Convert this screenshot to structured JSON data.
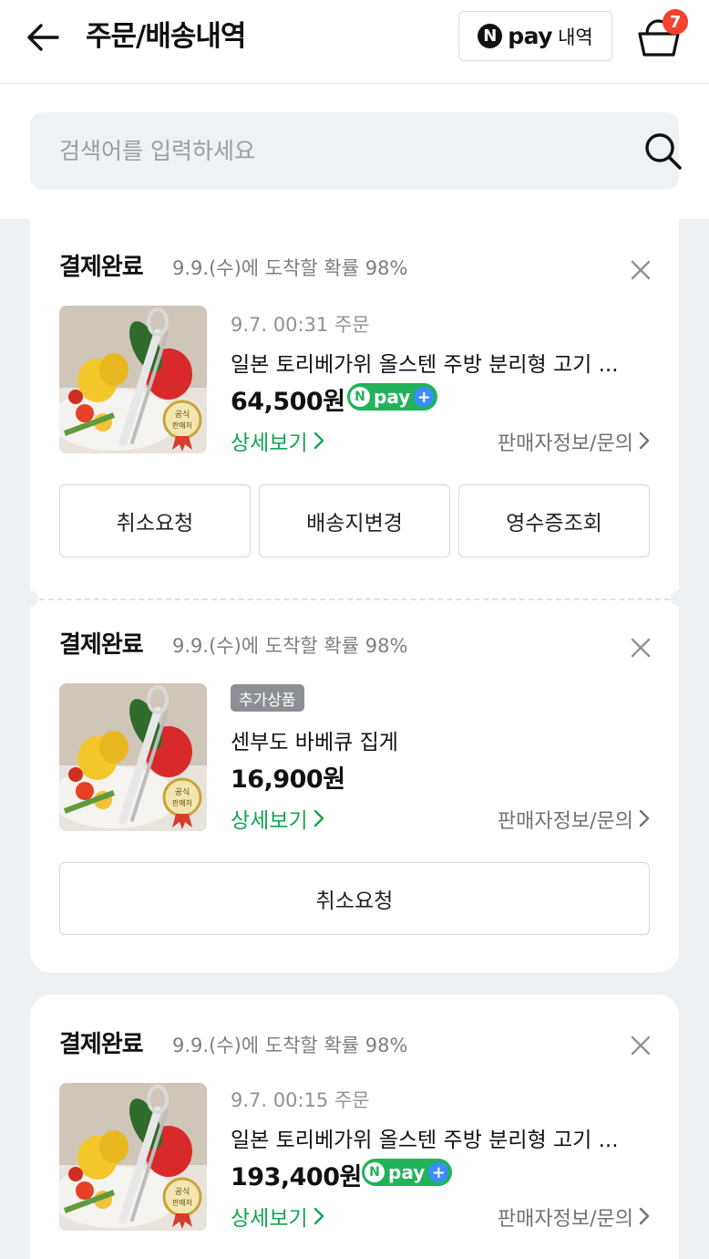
{
  "header": {
    "title": "주문/배송내역",
    "npay_n": "N",
    "npay_word": "pay",
    "npay_label": "내역",
    "cart_count": "7"
  },
  "search": {
    "placeholder": "검색어를 입력하세요"
  },
  "orders": [
    {
      "status": "결제완료",
      "eta": "9.9.(수)에 도착할 확률 98%",
      "order_date": "9.7. 00:31 주문",
      "product": "일본 토리베가위 올스텐 주방 분리형 고기 ...",
      "price": "64,500원",
      "npay_plus": true,
      "detail": "상세보기",
      "seller": "판매자정보/문의",
      "buttons": [
        "취소요청",
        "배송지변경",
        "영수증조회"
      ]
    },
    {
      "status": "결제완료",
      "eta": "9.9.(수)에 도착할 확률 98%",
      "badge": "추가상품",
      "product": "센부도 바베큐 집게",
      "price": "16,900원",
      "detail": "상세보기",
      "seller": "판매자정보/문의",
      "buttons": [
        "취소요청"
      ]
    },
    {
      "status": "결제완료",
      "eta": "9.9.(수)에 도착할 확률 98%",
      "order_date": "9.7. 00:15 주문",
      "product": "일본 토리베가위 올스텐 주방 분리형 고기 ...",
      "price": "193,400원",
      "npay_plus": true,
      "detail": "상세보기",
      "seller": "판매자정보/문의"
    }
  ],
  "badges": {
    "npay_plus_n": "N",
    "npay_plus_word": "pay",
    "npay_plus_sign": "+",
    "official_seal_line1": "공식",
    "official_seal_line2": "판매처"
  },
  "colors": {
    "accent_green": "#12a54f",
    "npay_green": "#21b35a",
    "badge_red": "#f5412d"
  },
  "icons": [
    "back-arrow-icon",
    "n-pay-icon",
    "cart-icon",
    "search-icon",
    "close-icon",
    "chevron-right-icon"
  ]
}
